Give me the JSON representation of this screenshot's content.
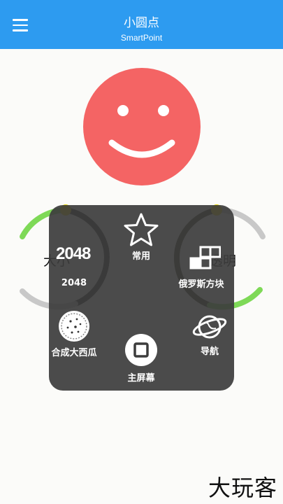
{
  "header": {
    "title": "小圆点",
    "subtitle": "SmartPoint"
  },
  "gauges": {
    "left_label": "大小",
    "right_label": "透明"
  },
  "menu": {
    "game_2048_number": "2048",
    "game_2048_label": "2048",
    "favorites_label": "常用",
    "tetris_label": "俄罗斯方块",
    "watermelon_label": "合成大西瓜",
    "navigation_label": "导航",
    "home_label": "主屏幕"
  },
  "watermark": "大玩客",
  "colors": {
    "appbar": "#2d9bf0",
    "smiley": "#f46464",
    "gauge_green": "#7ed957",
    "gauge_yellow": "#e8d500",
    "gauge_gray": "#c8c8c8",
    "panel": "#3c3c3c"
  }
}
